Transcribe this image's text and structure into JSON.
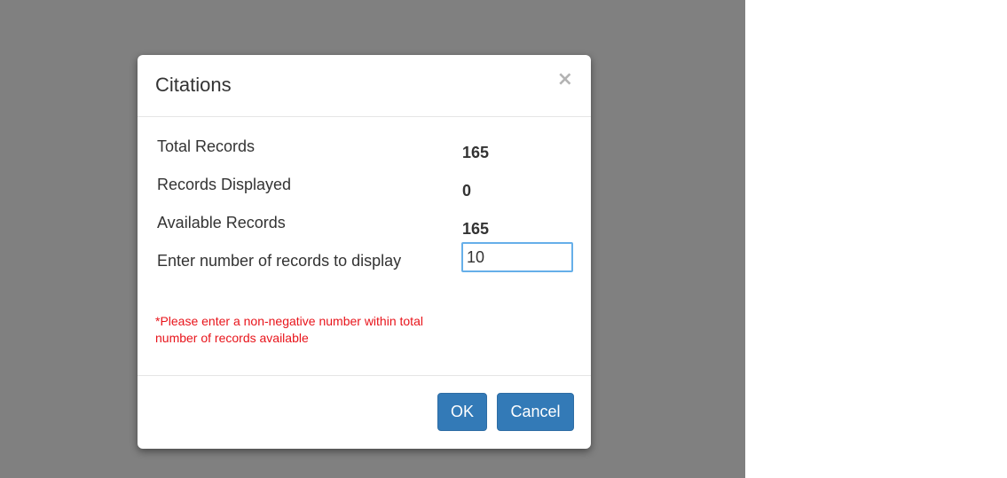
{
  "dialog": {
    "title": "Citations",
    "close_glyph": "×",
    "rows": [
      {
        "label": "Total Records",
        "value": "165"
      },
      {
        "label": "Records Displayed",
        "value": "0"
      },
      {
        "label": "Available Records",
        "value": "165"
      }
    ],
    "input_row": {
      "label": "Enter number of records to display",
      "value": "10"
    },
    "error_message": "*Please enter a non-negative number within total number of records available",
    "buttons": {
      "ok_label": "OK",
      "cancel_label": "Cancel"
    }
  },
  "colors": {
    "backdrop": "#808080",
    "primary_button": "#337ab7",
    "error_text": "#e8141b",
    "input_focus_border": "#66afe9"
  }
}
